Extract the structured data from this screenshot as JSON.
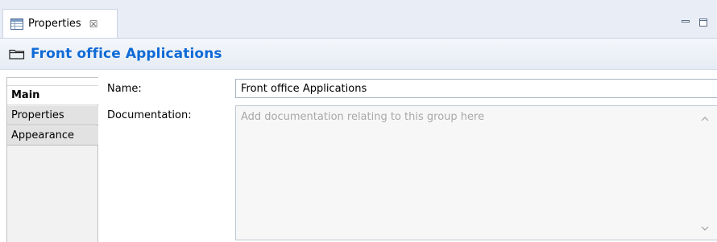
{
  "view_tab": {
    "title": "Properties",
    "close_glyph": "☒",
    "icon": "properties-table-icon"
  },
  "window_controls": {
    "minimize_icon": "minimize-icon",
    "maximize_icon": "maximize-icon"
  },
  "header": {
    "title": "Front office Applications",
    "icon": "folder-icon"
  },
  "side_tabs": [
    {
      "label": "Main",
      "selected": true
    },
    {
      "label": "Properties",
      "selected": false
    },
    {
      "label": "Appearance",
      "selected": false
    }
  ],
  "form": {
    "name_label": "Name:",
    "name_value": "Front office Applications",
    "documentation_label": "Documentation:",
    "documentation_placeholder": "Add documentation relating to this group here"
  },
  "colors": {
    "title": "#0e6ad6",
    "tabbar_bg": "#e9eef6",
    "placeholder": "#a8a8a8"
  }
}
